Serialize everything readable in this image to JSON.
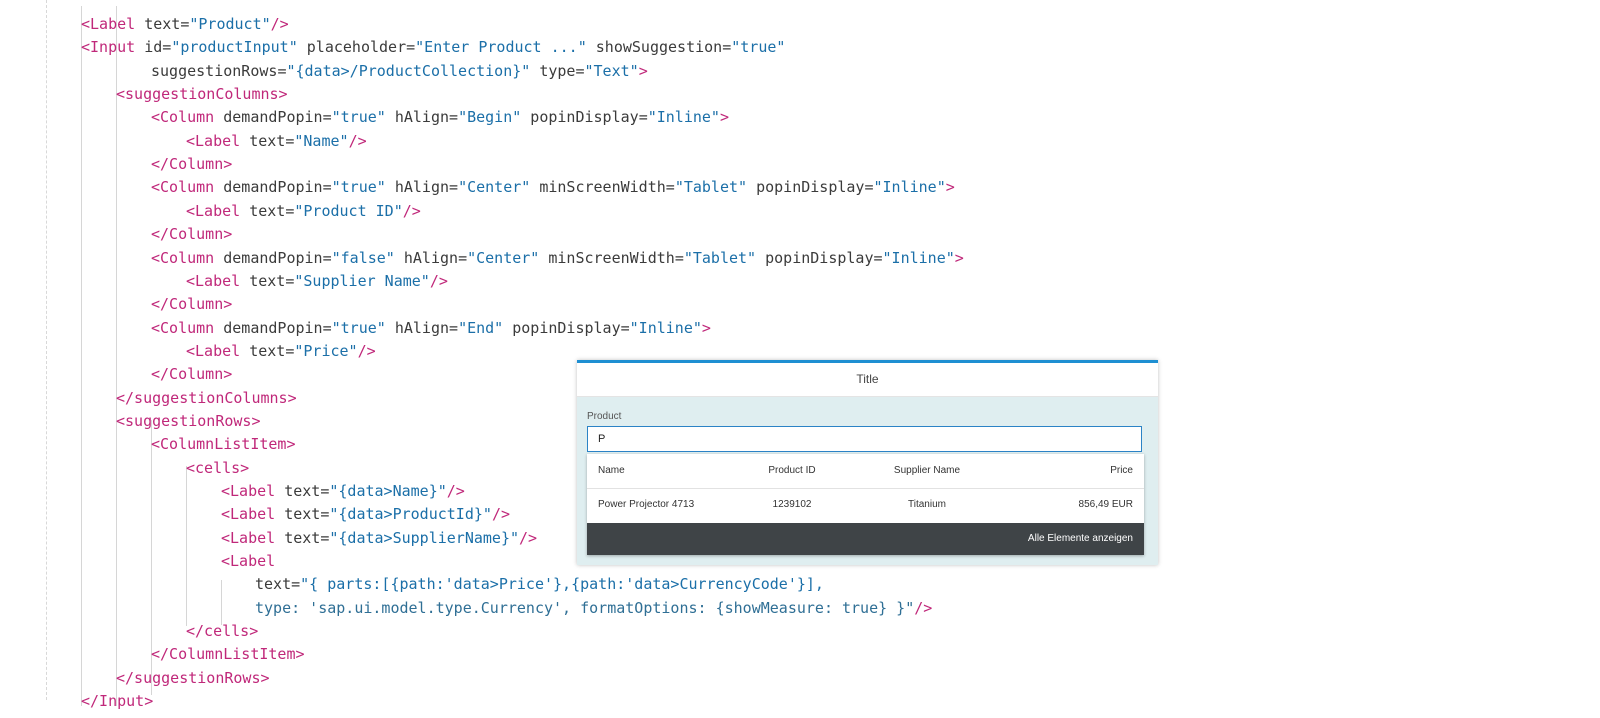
{
  "code": {
    "lines": [
      [
        [
          "tg",
          "<Label "
        ],
        [
          "at",
          "text"
        ],
        [
          "eq",
          "="
        ],
        [
          "st",
          "\"Product\""
        ],
        [
          "tg",
          "/>"
        ]
      ],
      [
        [
          "tg",
          "<Input "
        ],
        [
          "at",
          "id"
        ],
        [
          "eq",
          "="
        ],
        [
          "st",
          "\"productInput\""
        ],
        [
          "at",
          " placeholder"
        ],
        [
          "eq",
          "="
        ],
        [
          "st",
          "\"Enter Product ...\""
        ],
        [
          "at",
          " showSuggestion"
        ],
        [
          "eq",
          "="
        ],
        [
          "st",
          "\"true\""
        ]
      ],
      [
        [
          "at",
          "suggestionRows"
        ],
        [
          "eq",
          "="
        ],
        [
          "st",
          "\"{data>/ProductCollection}\""
        ],
        [
          "at",
          " type"
        ],
        [
          "eq",
          "="
        ],
        [
          "st",
          "\"Text\""
        ],
        [
          "tg",
          ">"
        ]
      ],
      [
        [
          "tg",
          "<suggestionColumns>"
        ]
      ],
      [
        [
          "tg",
          "<Column "
        ],
        [
          "at",
          "demandPopin"
        ],
        [
          "eq",
          "="
        ],
        [
          "st",
          "\"true\""
        ],
        [
          "at",
          " hAlign"
        ],
        [
          "eq",
          "="
        ],
        [
          "st",
          "\"Begin\""
        ],
        [
          "at",
          " popinDisplay"
        ],
        [
          "eq",
          "="
        ],
        [
          "st",
          "\"Inline\""
        ],
        [
          "tg",
          ">"
        ]
      ],
      [
        [
          "tg",
          "<Label "
        ],
        [
          "at",
          "text"
        ],
        [
          "eq",
          "="
        ],
        [
          "st",
          "\"Name\""
        ],
        [
          "tg",
          "/>"
        ]
      ],
      [
        [
          "tg",
          "</Column>"
        ]
      ],
      [
        [
          "tg",
          "<Column "
        ],
        [
          "at",
          "demandPopin"
        ],
        [
          "eq",
          "="
        ],
        [
          "st",
          "\"true\""
        ],
        [
          "at",
          " hAlign"
        ],
        [
          "eq",
          "="
        ],
        [
          "st",
          "\"Center\""
        ],
        [
          "at",
          " minScreenWidth"
        ],
        [
          "eq",
          "="
        ],
        [
          "st",
          "\"Tablet\""
        ],
        [
          "at",
          " popinDisplay"
        ],
        [
          "eq",
          "="
        ],
        [
          "st",
          "\"Inline\""
        ],
        [
          "tg",
          ">"
        ]
      ],
      [
        [
          "tg",
          "<Label "
        ],
        [
          "at",
          "text"
        ],
        [
          "eq",
          "="
        ],
        [
          "st",
          "\"Product ID\""
        ],
        [
          "tg",
          "/>"
        ]
      ],
      [
        [
          "tg",
          "</Column>"
        ]
      ],
      [
        [
          "tg",
          "<Column "
        ],
        [
          "at",
          "demandPopin"
        ],
        [
          "eq",
          "="
        ],
        [
          "st",
          "\"false\""
        ],
        [
          "at",
          " hAlign"
        ],
        [
          "eq",
          "="
        ],
        [
          "st",
          "\"Center\""
        ],
        [
          "at",
          " minScreenWidth"
        ],
        [
          "eq",
          "="
        ],
        [
          "st",
          "\"Tablet\""
        ],
        [
          "at",
          " popinDisplay"
        ],
        [
          "eq",
          "="
        ],
        [
          "st",
          "\"Inline\""
        ],
        [
          "tg",
          ">"
        ]
      ],
      [
        [
          "tg",
          "<Label "
        ],
        [
          "at",
          "text"
        ],
        [
          "eq",
          "="
        ],
        [
          "st",
          "\"Supplier Name\""
        ],
        [
          "tg",
          "/>"
        ]
      ],
      [
        [
          "tg",
          "</Column>"
        ]
      ],
      [
        [
          "tg",
          "<Column "
        ],
        [
          "at",
          "demandPopin"
        ],
        [
          "eq",
          "="
        ],
        [
          "st",
          "\"true\""
        ],
        [
          "at",
          " hAlign"
        ],
        [
          "eq",
          "="
        ],
        [
          "st",
          "\"End\""
        ],
        [
          "at",
          " popinDisplay"
        ],
        [
          "eq",
          "="
        ],
        [
          "st",
          "\"Inline\""
        ],
        [
          "tg",
          ">"
        ]
      ],
      [
        [
          "tg",
          "<Label "
        ],
        [
          "at",
          "text"
        ],
        [
          "eq",
          "="
        ],
        [
          "st",
          "\"Price\""
        ],
        [
          "tg",
          "/>"
        ]
      ],
      [
        [
          "tg",
          "</Column>"
        ]
      ],
      [
        [
          "tg",
          "</suggestionColumns>"
        ]
      ],
      [
        [
          "tg",
          "<suggestionRows>"
        ]
      ],
      [
        [
          "tg",
          "<ColumnListItem>"
        ]
      ],
      [
        [
          "tg",
          "<cells>"
        ]
      ],
      [
        [
          "tg",
          "<Label "
        ],
        [
          "at",
          "text"
        ],
        [
          "eq",
          "="
        ],
        [
          "st",
          "\"{data>Name}\""
        ],
        [
          "tg",
          "/>"
        ]
      ],
      [
        [
          "tg",
          "<Label "
        ],
        [
          "at",
          "text"
        ],
        [
          "eq",
          "="
        ],
        [
          "st",
          "\"{data>ProductId}\""
        ],
        [
          "tg",
          "/>"
        ]
      ],
      [
        [
          "tg",
          "<Label "
        ],
        [
          "at",
          "text"
        ],
        [
          "eq",
          "="
        ],
        [
          "st",
          "\"{data>SupplierName}\""
        ],
        [
          "tg",
          "/>"
        ]
      ],
      [
        [
          "tg",
          "<Label"
        ]
      ],
      [
        [
          "at",
          "text"
        ],
        [
          "eq",
          "="
        ],
        [
          "st",
          "\"{ parts:[{path:'data>Price'},{path:'data>CurrencyCode'}],"
        ]
      ],
      [
        [
          "pl",
          "type: 'sap.ui.model.type.Currency', formatOptions: {showMeasure: true} }\""
        ],
        [
          "tg",
          "/>"
        ]
      ],
      [
        [
          "tg",
          "</cells>"
        ]
      ],
      [
        [
          "tg",
          "</ColumnListItem>"
        ]
      ],
      [
        [
          "tg",
          "</suggestionRows>"
        ]
      ],
      [
        [
          "tg",
          "</Input>"
        ]
      ]
    ]
  },
  "dialog": {
    "title": "Title",
    "field_label": "Product",
    "input_value": "P",
    "columns": [
      "Name",
      "Product ID",
      "Supplier Name",
      "Price"
    ],
    "rows": [
      [
        "Power Projector 4713",
        "1239102",
        "Titanium",
        "856,49 EUR"
      ]
    ],
    "show_all_label": "Alle Elemente anzeigen",
    "accent_color": "#1e8fd2",
    "footer_color": "#3f4447"
  }
}
